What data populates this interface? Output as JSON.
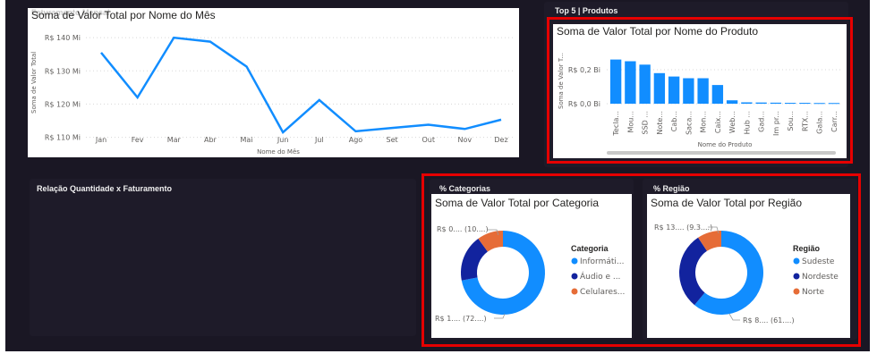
{
  "colors": {
    "accent": "#118dff",
    "dark_blue": "#12239e",
    "orange": "#e66c37",
    "highlight": "#e60000"
  },
  "line_visual": {
    "title": "Soma de Valor Total por Nome do Mês",
    "header_overlay": "Faturamento Mensal",
    "xlabel": "Nome do Mês",
    "ylabel": "Soma de Valor Total"
  },
  "products_panel": {
    "header": "Top 5 | Produtos",
    "title": "Soma de Valor Total por Nome do Produto",
    "xlabel": "Nome do Produto",
    "ylabel": "Soma de Valor T..."
  },
  "relation_panel": {
    "header": "Relação Quantidade x Faturamento"
  },
  "categories_panel": {
    "header": "% Categorias",
    "title": "Soma de Valor Total por Categoria",
    "legend_title": "Categoria",
    "legend": [
      "Informáti...",
      "Áudio e ...",
      "Celulares..."
    ],
    "label_top": "R$ 0.... (10....)",
    "label_bottom": "R$ 1.... (72....)"
  },
  "region_panel": {
    "header": "% Região",
    "title": "Soma de Valor Total por Região",
    "legend_title": "Região",
    "legend": [
      "Sudeste",
      "Nordeste",
      "Norte"
    ],
    "label_top": "R$ 13.... (9.3....)",
    "label_bottom": "R$ 8.... (61....)"
  },
  "chart_data": [
    {
      "type": "line",
      "title": "Soma de Valor Total por Nome do Mês",
      "xlabel": "Nome do Mês",
      "ylabel": "Soma de Valor Total",
      "categories": [
        "Jan",
        "Fev",
        "Mar",
        "Abr",
        "Mai",
        "Jun",
        "Jul",
        "Ago",
        "Set",
        "Out",
        "Nov",
        "Dez"
      ],
      "values": [
        135.5,
        122,
        140,
        138.8,
        131.3,
        111.5,
        121.2,
        111.8,
        112.8,
        113.8,
        112.5,
        115.3
      ],
      "yticks": [
        "R$ 110 Mi",
        "R$ 120 Mi",
        "R$ 130 Mi",
        "R$ 140 Mi"
      ],
      "ytick_values": [
        110,
        120,
        130,
        140
      ],
      "ylim": [
        108,
        143
      ],
      "grid": true
    },
    {
      "type": "bar",
      "title": "Soma de Valor Total por Nome do Produto",
      "xlabel": "Nome do Produto",
      "ylabel": "Soma de Valor T...",
      "categories": [
        "Tecla...",
        "Mou...",
        "SSD ...",
        "Note...",
        "Cab...",
        "Saca...",
        "Mon...",
        "Caix...",
        "Web...",
        "Hub ...",
        "Gad...",
        "Im pr...",
        "Sou...",
        "RTX...",
        "Gala...",
        "Carr..."
      ],
      "values": [
        0.26,
        0.25,
        0.23,
        0.18,
        0.16,
        0.15,
        0.15,
        0.11,
        0.02,
        0.008,
        0.007,
        0.006,
        0.005,
        0.005,
        0.004,
        0.004
      ],
      "yticks": [
        "R$ 0,0 Bi",
        "R$ 0,2 Bi"
      ],
      "ytick_values": [
        0,
        0.2
      ],
      "ylim": [
        0,
        0.3
      ]
    },
    {
      "type": "pie",
      "title": "Soma de Valor Total por Categoria",
      "labels": [
        "Informáti...",
        "Áudio e ...",
        "Celulares..."
      ],
      "values": [
        72,
        18,
        10
      ]
    },
    {
      "type": "pie",
      "title": "Soma de Valor Total por Região",
      "labels": [
        "Sudeste",
        "Nordeste",
        "Norte"
      ],
      "values": [
        61,
        29.7,
        9.3
      ]
    }
  ]
}
